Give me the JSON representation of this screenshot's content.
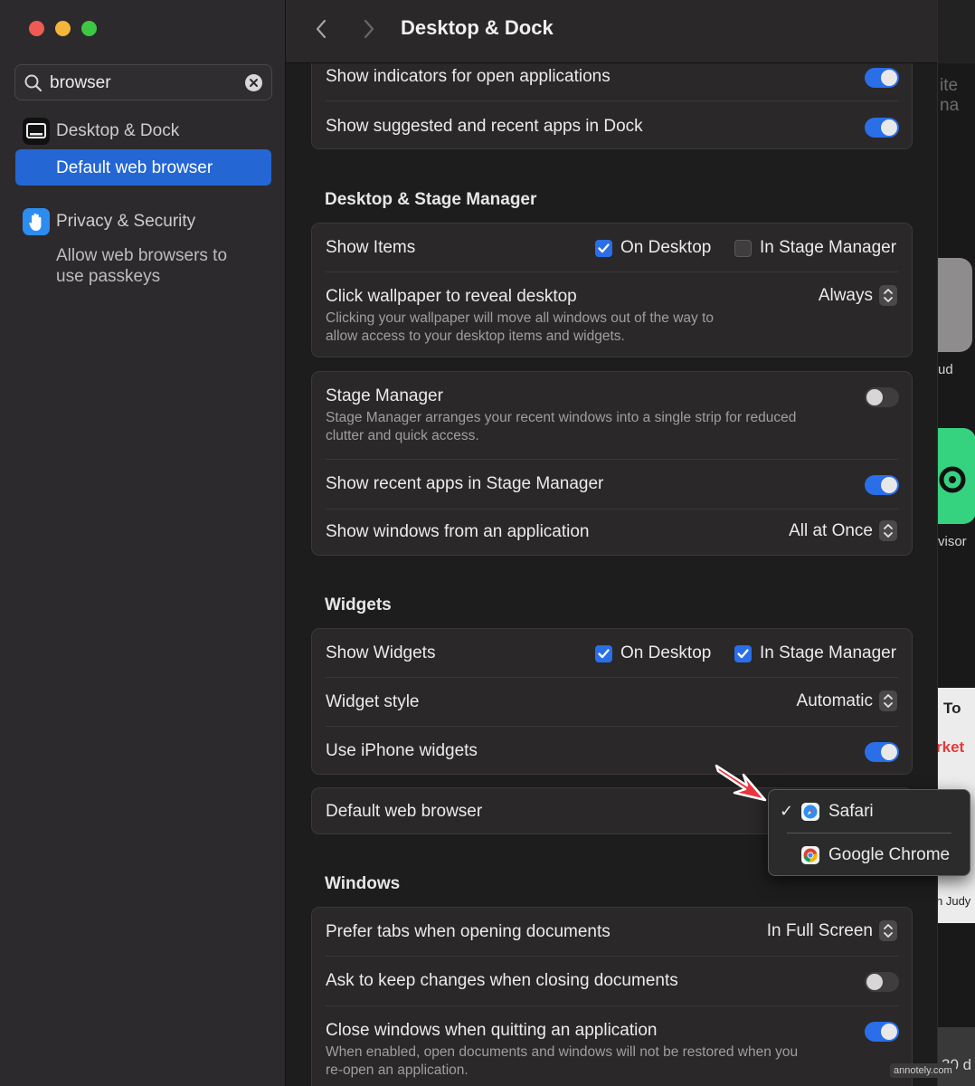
{
  "sidebar": {
    "search": {
      "value": "browser"
    },
    "results": [
      {
        "label": "Desktop & Dock",
        "sub": "Default web browser"
      },
      {
        "label": "Privacy & Security",
        "sub_line1": "Allow web browsers to",
        "sub_line2": "use passkeys"
      }
    ]
  },
  "header": {
    "title": "Desktop & Dock"
  },
  "dock": {
    "rows": [
      {
        "label": "Show indicators for open applications",
        "on": true
      },
      {
        "label": "Show suggested and recent apps in Dock",
        "on": true
      }
    ]
  },
  "stage_section": {
    "heading": "Desktop & Stage Manager",
    "show_items": {
      "label": "Show Items",
      "on_desktop": "On Desktop",
      "in_stage": "In Stage Manager"
    },
    "click_wallpaper": {
      "label": "Click wallpaper to reveal desktop",
      "value": "Always",
      "desc_line1": "Clicking your wallpaper will move all windows out of the way to",
      "desc_line2": "allow access to your desktop items and widgets."
    },
    "stage_manager": {
      "label": "Stage Manager",
      "desc_line1": "Stage Manager arranges your recent windows into a single strip for reduced",
      "desc_line2": "clutter and quick access."
    },
    "recent_apps": {
      "label": "Show recent apps in Stage Manager"
    },
    "windows_from_app": {
      "label": "Show windows from an application",
      "value": "All at Once"
    }
  },
  "widgets_section": {
    "heading": "Widgets",
    "show_widgets": {
      "label": "Show Widgets",
      "on_desktop": "On Desktop",
      "in_stage": "In Stage Manager"
    },
    "widget_style": {
      "label": "Widget style",
      "value": "Automatic"
    },
    "iphone_widgets": {
      "label": "Use iPhone widgets"
    }
  },
  "default_browser": {
    "label": "Default web browser"
  },
  "browser_menu": {
    "items": [
      {
        "label": "Safari",
        "checked": "✓"
      },
      {
        "label": "Google Chrome"
      }
    ]
  },
  "windows_section": {
    "heading": "Windows",
    "prefer_tabs": {
      "label": "Prefer tabs when opening documents",
      "value": "In Full Screen"
    },
    "ask_keep": {
      "label": "Ask to keep changes when closing documents"
    },
    "close_windows": {
      "label": "Close windows when quitting an application",
      "desc_line1": "When enabled, open documents and windows will not be restored when you",
      "desc_line2": "re-open an application."
    }
  },
  "background": {
    "fragments": [
      "ite na",
      "ud",
      "visor",
      "To",
      "rket",
      "n Judy",
      "30 d"
    ]
  },
  "watermark": "annotely.com",
  "colors": {
    "accent": "#2a6ee8",
    "selection": "#2466d4",
    "arrow": "#e8363f"
  }
}
